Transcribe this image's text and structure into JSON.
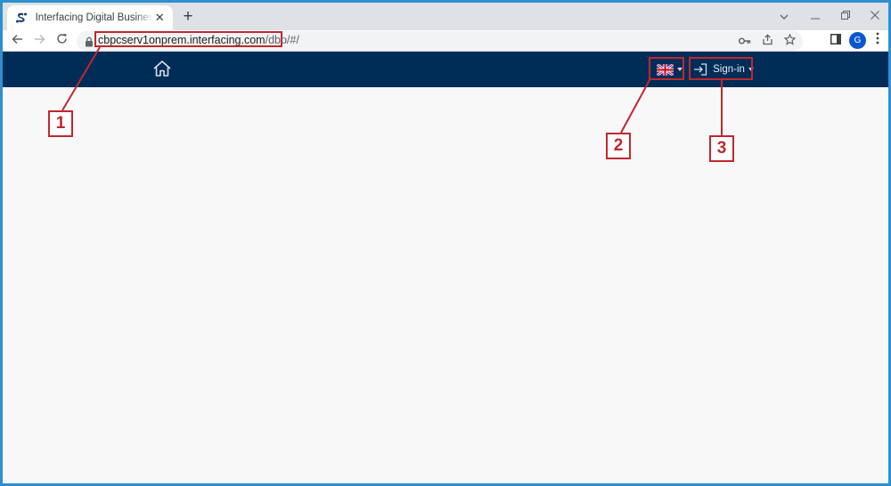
{
  "browser": {
    "tab_title": "Interfacing Digital Business Platform",
    "tab_close": "✕",
    "new_tab": "+",
    "url_host": "cbpcserv1onprem.interfacing.com",
    "url_path": "/dbp/#/",
    "profile_initial": "G"
  },
  "app": {
    "signin_label": "Sign-in",
    "language": "English (UK)"
  },
  "callouts": {
    "one": "1",
    "two": "2",
    "three": "3",
    "color": "#c0282d"
  },
  "colors": {
    "navbar": "#002d57",
    "frame_border": "#2f8fd0"
  },
  "icons": {
    "favicon": "interfacing-logo-icon",
    "home": "home-icon",
    "flag": "uk-flag-icon",
    "signin": "sign-in-icon"
  }
}
